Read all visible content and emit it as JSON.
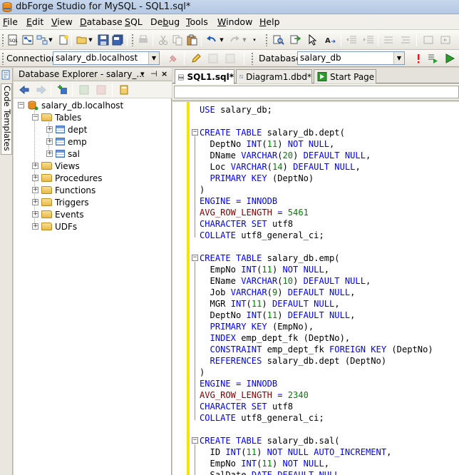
{
  "window": {
    "title": "dbForge Studio for MySQL - SQL1.sql*"
  },
  "menu": [
    {
      "pre": "",
      "ul": "F",
      "post": "ile"
    },
    {
      "pre": "",
      "ul": "E",
      "post": "dit"
    },
    {
      "pre": "",
      "ul": "V",
      "post": "iew"
    },
    {
      "pre": "",
      "ul": "D",
      "post": "atabase"
    },
    {
      "pre": "",
      "ul": "S",
      "post": "QL"
    },
    {
      "pre": "De",
      "ul": "b",
      "post": "ug"
    },
    {
      "pre": "",
      "ul": "T",
      "post": "ools"
    },
    {
      "pre": "",
      "ul": "W",
      "post": "indow"
    },
    {
      "pre": "",
      "ul": "H",
      "post": "elp"
    }
  ],
  "toolbar2": {
    "connection_label": "Connection",
    "connection_value": "salary_db.localhost",
    "database_label": "Database",
    "database_value": "salary_db"
  },
  "side_strip": {
    "tab_label": "Code Templates"
  },
  "explorer": {
    "title": "Database Explorer - salary_...",
    "tree": {
      "root": "salary_db.localhost",
      "tables_label": "Tables",
      "tables": [
        "dept",
        "emp",
        "sal"
      ],
      "folders": [
        "Views",
        "Procedures",
        "Functions",
        "Triggers",
        "Events",
        "UDFs"
      ]
    }
  },
  "tabs": [
    {
      "label": "SQL1.sql*",
      "active": true
    },
    {
      "label": "Diagram1.dbd*",
      "active": false
    },
    {
      "label": "Start Page",
      "active": false
    }
  ],
  "code_lines": [
    [
      {
        "t": "USE ",
        "c": "kw"
      },
      {
        "t": "salary_db;",
        "c": "plain"
      }
    ],
    [],
    [
      {
        "t": "CREATE TABLE ",
        "c": "kw"
      },
      {
        "t": "salary_db.dept(",
        "c": "plain"
      }
    ],
    [
      {
        "t": "  DeptNo ",
        "c": "plain"
      },
      {
        "t": "INT",
        "c": "kw"
      },
      {
        "t": "(",
        "c": "plain"
      },
      {
        "t": "11",
        "c": "num"
      },
      {
        "t": ") ",
        "c": "plain"
      },
      {
        "t": "NOT NULL",
        "c": "kw"
      },
      {
        "t": ",",
        "c": "plain"
      }
    ],
    [
      {
        "t": "  DName ",
        "c": "plain"
      },
      {
        "t": "VARCHAR",
        "c": "kw"
      },
      {
        "t": "(",
        "c": "plain"
      },
      {
        "t": "20",
        "c": "num"
      },
      {
        "t": ") ",
        "c": "plain"
      },
      {
        "t": "DEFAULT NULL",
        "c": "kw"
      },
      {
        "t": ",",
        "c": "plain"
      }
    ],
    [
      {
        "t": "  Loc ",
        "c": "plain"
      },
      {
        "t": "VARCHAR",
        "c": "kw"
      },
      {
        "t": "(",
        "c": "plain"
      },
      {
        "t": "14",
        "c": "num"
      },
      {
        "t": ") ",
        "c": "plain"
      },
      {
        "t": "DEFAULT NULL",
        "c": "kw"
      },
      {
        "t": ",",
        "c": "plain"
      }
    ],
    [
      {
        "t": "  PRIMARY KEY ",
        "c": "kw"
      },
      {
        "t": "(DeptNo)",
        "c": "plain"
      }
    ],
    [
      {
        "t": ")",
        "c": "plain"
      }
    ],
    [
      {
        "t": "ENGINE ",
        "c": "kw"
      },
      {
        "t": "= ",
        "c": "op"
      },
      {
        "t": "INNODB",
        "c": "kw"
      }
    ],
    [
      {
        "t": "AVG_ROW_LENGTH ",
        "c": "fn"
      },
      {
        "t": "= ",
        "c": "op"
      },
      {
        "t": "5461",
        "c": "num"
      }
    ],
    [
      {
        "t": "CHARACTER SET ",
        "c": "kw"
      },
      {
        "t": "utf8",
        "c": "plain"
      }
    ],
    [
      {
        "t": "COLLATE ",
        "c": "kw"
      },
      {
        "t": "utf8_general_ci;",
        "c": "plain"
      }
    ],
    [],
    [
      {
        "t": "CREATE TABLE ",
        "c": "kw"
      },
      {
        "t": "salary_db.emp(",
        "c": "plain"
      }
    ],
    [
      {
        "t": "  EmpNo ",
        "c": "plain"
      },
      {
        "t": "INT",
        "c": "kw"
      },
      {
        "t": "(",
        "c": "plain"
      },
      {
        "t": "11",
        "c": "num"
      },
      {
        "t": ") ",
        "c": "plain"
      },
      {
        "t": "NOT NULL",
        "c": "kw"
      },
      {
        "t": ",",
        "c": "plain"
      }
    ],
    [
      {
        "t": "  EName ",
        "c": "plain"
      },
      {
        "t": "VARCHAR",
        "c": "kw"
      },
      {
        "t": "(",
        "c": "plain"
      },
      {
        "t": "10",
        "c": "num"
      },
      {
        "t": ") ",
        "c": "plain"
      },
      {
        "t": "DEFAULT NULL",
        "c": "kw"
      },
      {
        "t": ",",
        "c": "plain"
      }
    ],
    [
      {
        "t": "  Job ",
        "c": "plain"
      },
      {
        "t": "VARCHAR",
        "c": "kw"
      },
      {
        "t": "(",
        "c": "plain"
      },
      {
        "t": "9",
        "c": "num"
      },
      {
        "t": ") ",
        "c": "plain"
      },
      {
        "t": "DEFAULT NULL",
        "c": "kw"
      },
      {
        "t": ",",
        "c": "plain"
      }
    ],
    [
      {
        "t": "  MGR ",
        "c": "plain"
      },
      {
        "t": "INT",
        "c": "kw"
      },
      {
        "t": "(",
        "c": "plain"
      },
      {
        "t": "11",
        "c": "num"
      },
      {
        "t": ") ",
        "c": "plain"
      },
      {
        "t": "DEFAULT NULL",
        "c": "kw"
      },
      {
        "t": ",",
        "c": "plain"
      }
    ],
    [
      {
        "t": "  DeptNo ",
        "c": "plain"
      },
      {
        "t": "INT",
        "c": "kw"
      },
      {
        "t": "(",
        "c": "plain"
      },
      {
        "t": "11",
        "c": "num"
      },
      {
        "t": ") ",
        "c": "plain"
      },
      {
        "t": "DEFAULT NULL",
        "c": "kw"
      },
      {
        "t": ",",
        "c": "plain"
      }
    ],
    [
      {
        "t": "  PRIMARY KEY ",
        "c": "kw"
      },
      {
        "t": "(EmpNo),",
        "c": "plain"
      }
    ],
    [
      {
        "t": "  INDEX ",
        "c": "kw"
      },
      {
        "t": "emp_dept_fk (DeptNo),",
        "c": "plain"
      }
    ],
    [
      {
        "t": "  CONSTRAINT ",
        "c": "kw"
      },
      {
        "t": "emp_dept_fk ",
        "c": "plain"
      },
      {
        "t": "FOREIGN KEY ",
        "c": "kw"
      },
      {
        "t": "(DeptNo)",
        "c": "plain"
      }
    ],
    [
      {
        "t": "  REFERENCES ",
        "c": "kw"
      },
      {
        "t": "salary_db.dept (DeptNo)",
        "c": "plain"
      }
    ],
    [
      {
        "t": ")",
        "c": "plain"
      }
    ],
    [
      {
        "t": "ENGINE ",
        "c": "kw"
      },
      {
        "t": "= ",
        "c": "op"
      },
      {
        "t": "INNODB",
        "c": "kw"
      }
    ],
    [
      {
        "t": "AVG_ROW_LENGTH ",
        "c": "fn"
      },
      {
        "t": "= ",
        "c": "op"
      },
      {
        "t": "2340",
        "c": "num"
      }
    ],
    [
      {
        "t": "CHARACTER SET ",
        "c": "kw"
      },
      {
        "t": "utf8",
        "c": "plain"
      }
    ],
    [
      {
        "t": "COLLATE ",
        "c": "kw"
      },
      {
        "t": "utf8_general_ci;",
        "c": "plain"
      }
    ],
    [],
    [
      {
        "t": "CREATE TABLE ",
        "c": "kw"
      },
      {
        "t": "salary_db.sal(",
        "c": "plain"
      }
    ],
    [
      {
        "t": "  ID ",
        "c": "plain"
      },
      {
        "t": "INT",
        "c": "kw"
      },
      {
        "t": "(",
        "c": "plain"
      },
      {
        "t": "11",
        "c": "num"
      },
      {
        "t": ") ",
        "c": "plain"
      },
      {
        "t": "NOT NULL AUTO_INCREMENT",
        "c": "kw"
      },
      {
        "t": ",",
        "c": "plain"
      }
    ],
    [
      {
        "t": "  EmpNo ",
        "c": "plain"
      },
      {
        "t": "INT",
        "c": "kw"
      },
      {
        "t": "(",
        "c": "plain"
      },
      {
        "t": "11",
        "c": "num"
      },
      {
        "t": ") ",
        "c": "plain"
      },
      {
        "t": "NOT NULL",
        "c": "kw"
      },
      {
        "t": ",",
        "c": "plain"
      }
    ],
    [
      {
        "t": "  SalDate ",
        "c": "plain"
      },
      {
        "t": "DATE DEFAULT NULL",
        "c": "kw"
      },
      {
        "t": ",",
        "c": "plain"
      }
    ]
  ],
  "colors": {
    "keyword": "#0000ff",
    "number": "#008000",
    "function": "#800000",
    "change_bar": "#f5e400"
  }
}
